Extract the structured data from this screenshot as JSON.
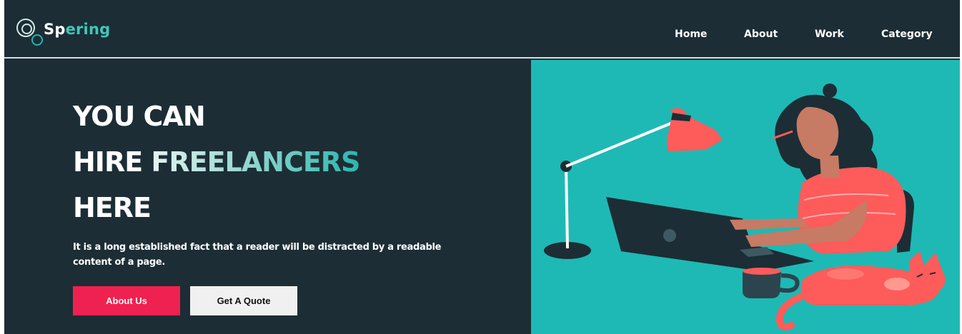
{
  "brand": {
    "name_part1": "Sp",
    "name_part2": "ering",
    "logo_icon": "circles-logo-icon"
  },
  "nav": {
    "items": [
      {
        "label": "Home"
      },
      {
        "label": "About"
      },
      {
        "label": "Work"
      },
      {
        "label": "Category"
      }
    ]
  },
  "hero": {
    "line1": "YOU CAN",
    "line2_plain": "HIRE ",
    "line2_accent": "FREELANCERS",
    "line3": "HERE",
    "description": "It is a long established fact that a reader will be distracted by a readable content of a page.",
    "primary_button": "About Us",
    "secondary_button": "Get A Quote"
  },
  "colors": {
    "background": "#1c2d35",
    "accent": "#1eb9b4",
    "primary_button": "#ef2150",
    "secondary_button": "#f0f0f0",
    "illustration_coral": "#fe5b5b"
  },
  "illustration": {
    "name": "freelancer-working-on-laptop-illustration"
  }
}
